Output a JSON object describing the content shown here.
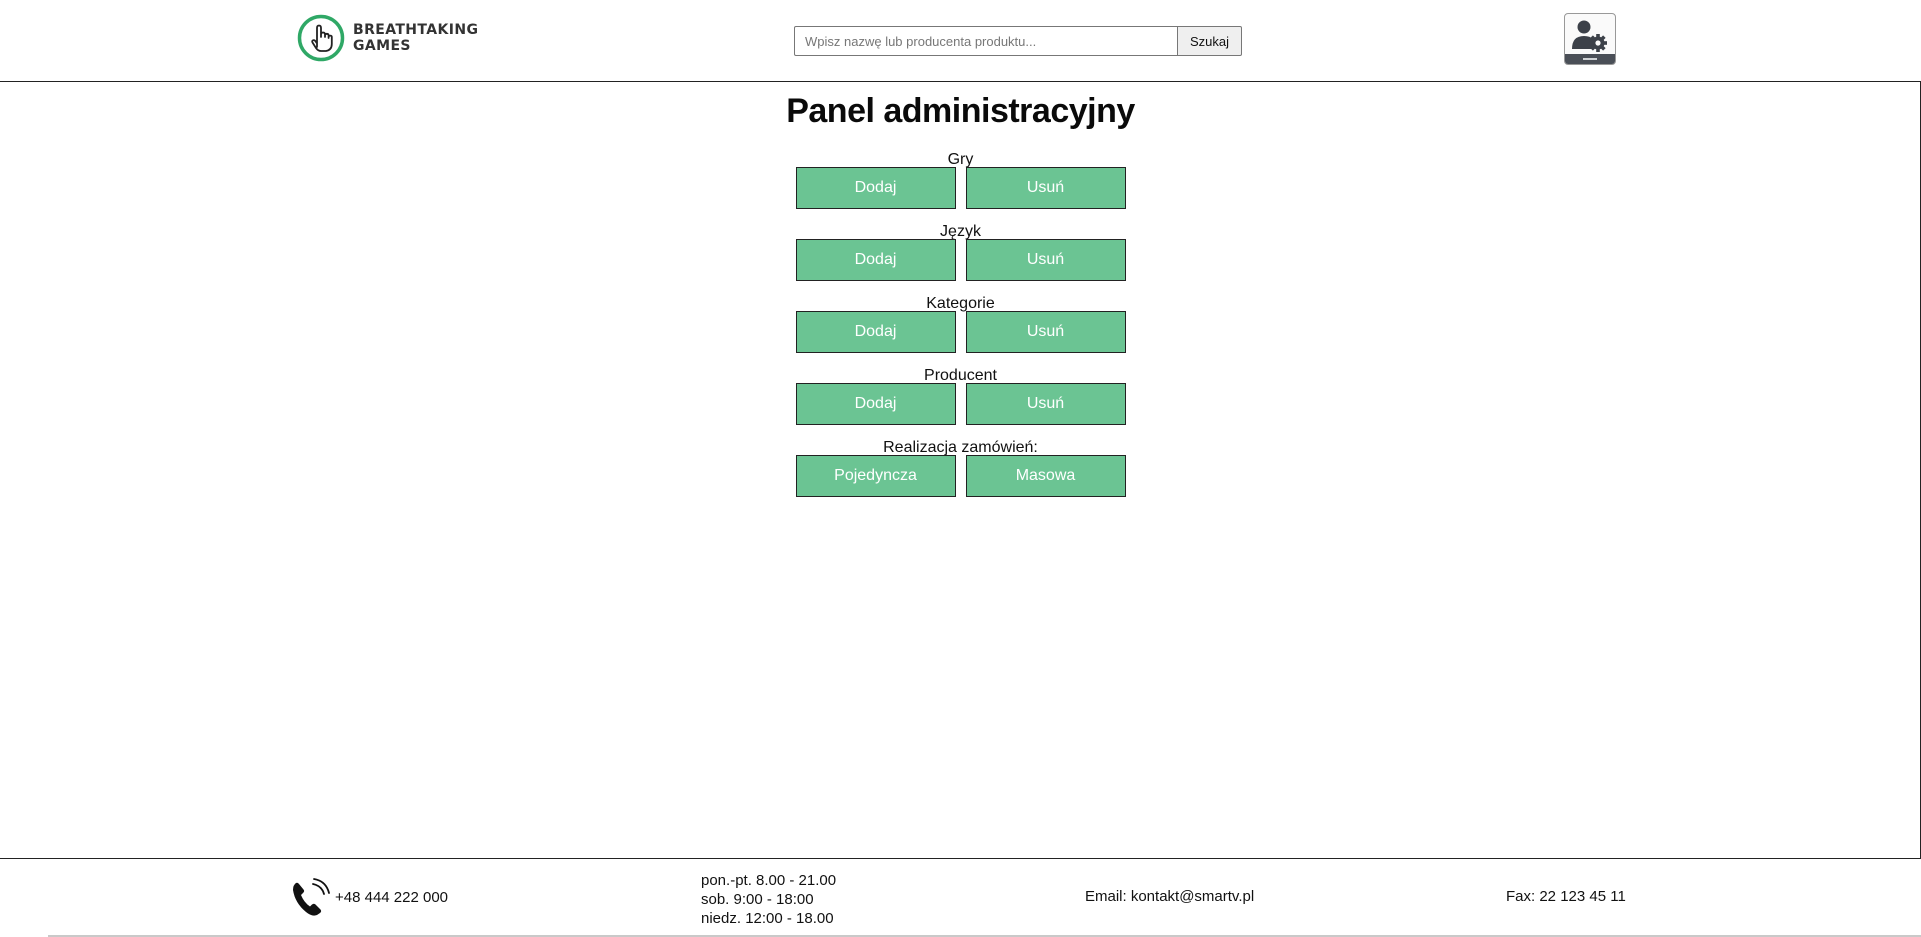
{
  "brand": {
    "line1": "BREATHTAKING",
    "line2": "GAMES",
    "accent_color": "#2fa866"
  },
  "search": {
    "placeholder": "Wpisz nazwę lub producenta produktu...",
    "value": "",
    "button_label": "Szukaj"
  },
  "header": {
    "admin_icon": "admin-settings-icon"
  },
  "main": {
    "title": "Panel administracyjny",
    "button_color": "#6bc493",
    "sections": [
      {
        "label": "Gry",
        "left_button": "Dodaj",
        "right_button": "Usuń"
      },
      {
        "label": "Język",
        "left_button": "Dodaj",
        "right_button": "Usuń"
      },
      {
        "label": "Kategorie",
        "left_button": "Dodaj",
        "right_button": "Usuń"
      },
      {
        "label": "Producent",
        "left_button": "Dodaj",
        "right_button": "Usuń"
      },
      {
        "label": "Realizacja zamówień:",
        "left_button": "Pojedyncza",
        "right_button": "Masowa"
      }
    ]
  },
  "footer": {
    "phone": "+48 444 222 000",
    "phone_icon": "phone-icon",
    "hours": {
      "weekdays": "pon.-pt. 8.00 - 21.00",
      "saturday": "sob. 9:00 - 18:00",
      "sunday": "niedz. 12:00 - 18.00"
    },
    "email": "Email: kontakt@smartv.pl",
    "fax": "Fax: 22 123 45 11"
  }
}
